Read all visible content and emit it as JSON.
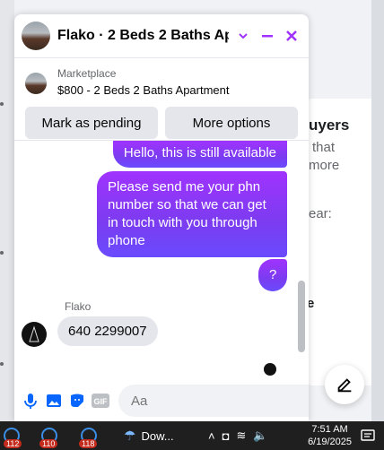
{
  "background": {
    "heading_fragment": "uyers",
    "line1_fragment": "that",
    "line2_fragment": "more",
    "line3_fragment": "ear:",
    "fragment_e": "e"
  },
  "chat": {
    "title": "Flako · 2 Beds 2 Baths Apa...",
    "listing_source": "Marketplace",
    "listing_title": "$800 - 2 Beds 2 Baths Apartment",
    "btn_pending": "Mark as pending",
    "btn_more": "More options",
    "messages": {
      "m1": "Hello, this is still available",
      "m2": "Please send me your phn number so that we can get in touch with you through phone",
      "m3": "?",
      "sender": "Flako",
      "reply": "640 2299007"
    },
    "composer_placeholder": "Aa"
  },
  "taskbar": {
    "badge1": "112",
    "badge2": "110",
    "badge3": "118",
    "weather_label": "Dow...",
    "time": "7:51 AM",
    "date": "6/19/2025"
  },
  "colors": {
    "accent": "#a033ff",
    "messenger_blue": "#0866ff"
  }
}
